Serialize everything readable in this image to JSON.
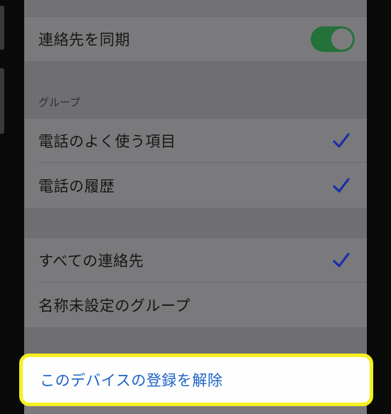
{
  "settings": {
    "sync_contacts": {
      "label": "連絡先を同期",
      "enabled": true
    },
    "groups_header": "グループ",
    "group_items": [
      {
        "label": "電話のよく使う項目",
        "checked": true
      },
      {
        "label": "電話の履歴",
        "checked": true
      }
    ],
    "all_items": [
      {
        "label": "すべての連絡先",
        "checked": true
      },
      {
        "label": "名称未設定のグループ",
        "checked": false
      }
    ],
    "unregister_label": "このデバイスの登録を解除"
  },
  "colors": {
    "toggle_on": "#24713a",
    "checkmark": "#1b2fa8",
    "destructive_link": "#1b63c4",
    "highlight_border": "#f5f01f"
  },
  "icons": {
    "checkmark": "checkmark-icon"
  }
}
